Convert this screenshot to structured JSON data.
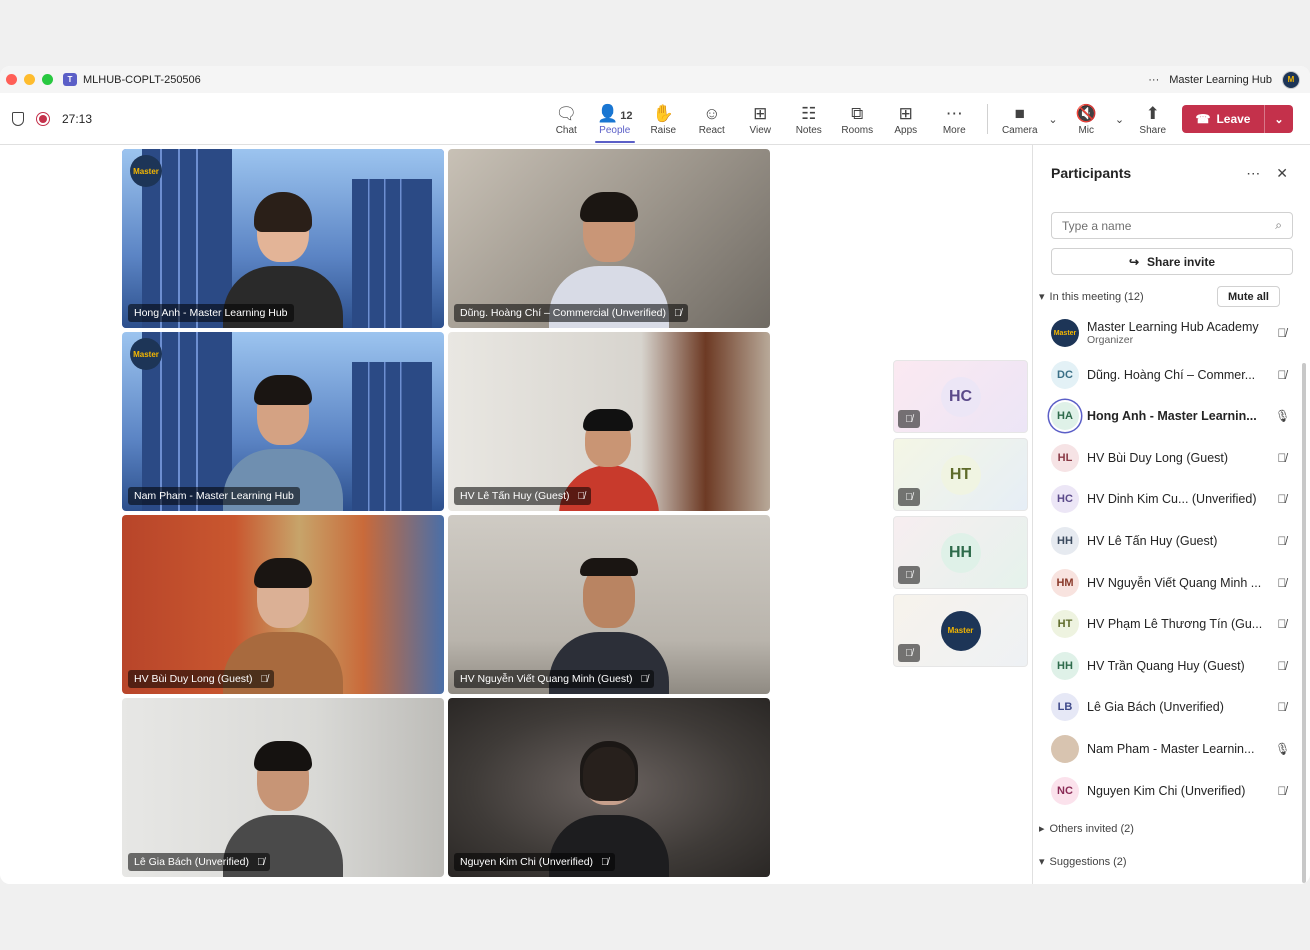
{
  "window": {
    "title": "MLHUB-COPLT-250506",
    "org_name": "Master Learning Hub",
    "more": "···"
  },
  "call": {
    "duration": "27:13"
  },
  "toolbar": {
    "items": [
      {
        "label": "Chat",
        "icon": "chat-icon",
        "glyph": "💬"
      },
      {
        "label": "People",
        "icon": "people-icon",
        "glyph": "👤",
        "count": "12",
        "active": true
      },
      {
        "label": "Raise",
        "icon": "raise-hand-icon",
        "glyph": "✋"
      },
      {
        "label": "React",
        "icon": "react-icon",
        "glyph": "☺"
      },
      {
        "label": "View",
        "icon": "view-icon",
        "glyph": "⊞"
      },
      {
        "label": "Notes",
        "icon": "notes-icon",
        "glyph": "📋"
      },
      {
        "label": "Rooms",
        "icon": "rooms-icon",
        "glyph": "⧉"
      },
      {
        "label": "Apps",
        "icon": "apps-icon",
        "glyph": "⊕"
      },
      {
        "label": "More",
        "icon": "more-icon",
        "glyph": "···"
      }
    ],
    "camera_label": "Camera",
    "mic_label": "Mic",
    "share_label": "Share",
    "leave_label": "Leave"
  },
  "stage": {
    "tiles": [
      {
        "name": "Hong Anh - Master Learning Hub",
        "muted": false
      },
      {
        "name": "Dũng. Hoàng Chí – Commercial (Unverified)",
        "muted": true
      },
      {
        "name": "Nam Pham - Master Learning Hub",
        "muted": false
      },
      {
        "name": "HV Lê Tấn Huy (Guest)",
        "muted": true
      },
      {
        "name": "HV Bùi Duy Long (Guest)",
        "muted": true
      },
      {
        "name": "HV Nguyễn Viết Quang Minh (Guest)",
        "muted": true
      },
      {
        "name": "Lê Gia Bách (Unverified)",
        "muted": true
      },
      {
        "name": "Nguyen Kim Chi (Unverified)",
        "muted": true
      }
    ],
    "mini_tiles": [
      {
        "initials": "HC"
      },
      {
        "initials": "HT"
      },
      {
        "initials": "HH"
      },
      {
        "initials": "Master"
      }
    ],
    "logo_text": "Master"
  },
  "panel": {
    "title": "Participants",
    "search_placeholder": "Type a name",
    "share_invite": "Share invite",
    "in_meeting": "In this meeting (12)",
    "mute_all": "Mute all",
    "participants": [
      {
        "initials": "Master",
        "name": "Master Learning Hub Academy",
        "role": "Organizer",
        "mic": "off"
      },
      {
        "initials": "DC",
        "name": "Dũng. Hoàng Chí – Commer...",
        "role": "",
        "mic": "off"
      },
      {
        "initials": "HA",
        "name": "Hong Anh - Master Learnin...",
        "role": "",
        "mic": "on",
        "bold": true
      },
      {
        "initials": "HL",
        "name": "HV Bùi Duy Long (Guest)",
        "role": "",
        "mic": "off"
      },
      {
        "initials": "HC",
        "name": "HV Dinh Kim Cu...  (Unverified)",
        "role": "",
        "mic": "off"
      },
      {
        "initials": "HH",
        "name": "HV Lê Tấn Huy (Guest)",
        "role": "",
        "mic": "off"
      },
      {
        "initials": "HM",
        "name": "HV Nguyễn Viết Quang Minh ...",
        "role": "",
        "mic": "off"
      },
      {
        "initials": "HT",
        "name": "HV Phạm Lê Thương Tín (Gu...",
        "role": "",
        "mic": "off"
      },
      {
        "initials": "HH",
        "name": "HV Trần Quang Huy (Guest)",
        "role": "",
        "mic": "off"
      },
      {
        "initials": "LB",
        "name": "Lê Gia Bách (Unverified)",
        "role": "",
        "mic": "off"
      },
      {
        "initials": "",
        "name": "Nam Pham - Master Learnin...",
        "role": "",
        "mic": "on"
      },
      {
        "initials": "NC",
        "name": "Nguyen Kim Chi (Unverified)",
        "role": "",
        "mic": "off"
      }
    ],
    "others_invited": "Others invited (2)",
    "suggestions": "Suggestions (2)"
  }
}
